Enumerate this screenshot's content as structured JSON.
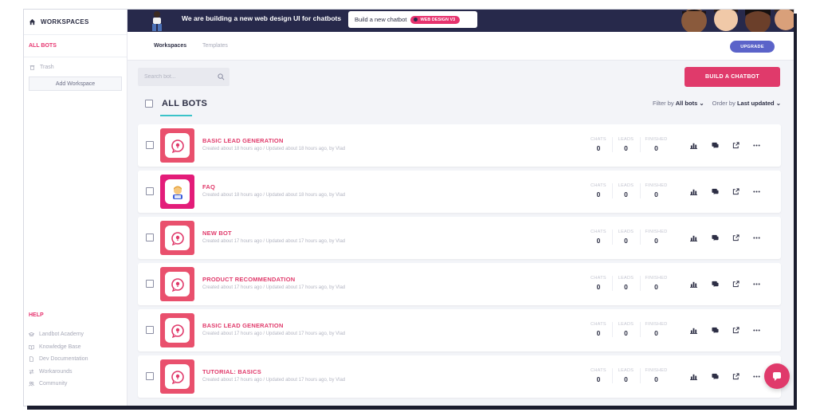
{
  "sidebar": {
    "workspaces_label": "WORKSPACES",
    "all_bots_label": "ALL BOTS",
    "trash_label": "Trash",
    "add_workspace_label": "Add Workspace",
    "help_title": "HELP",
    "help_items": [
      {
        "label": "Landbot Academy",
        "icon": "graduation-icon"
      },
      {
        "label": "Knowledge Base",
        "icon": "book-icon"
      },
      {
        "label": "Dev Documentation",
        "icon": "document-icon"
      },
      {
        "label": "Workarounds",
        "icon": "swap-icon"
      },
      {
        "label": "Community",
        "icon": "people-icon"
      }
    ]
  },
  "banner": {
    "text": "We are building a new web design UI for chatbots",
    "pill_text": "Build a new chatbot",
    "badge_text": "WEB DESIGN V3"
  },
  "topnav": {
    "tabs": [
      "Workspaces",
      "Templates"
    ],
    "upgrade_label": "UPGRADE"
  },
  "search": {
    "placeholder": "Search bot..."
  },
  "build_button_label": "BUILD A CHATBOT",
  "list": {
    "title": "ALL BOTS",
    "filter_label": "Filter by",
    "filter_value": "All bots",
    "order_label": "Order by",
    "order_value": "Last updated"
  },
  "stat_labels": {
    "chats": "CHATS",
    "leads": "LEADS",
    "finished": "FINISHED"
  },
  "bots": [
    {
      "name": "BASIC LEAD GENERATION",
      "meta": "Created about 18 hours ago / Updated about 18 hours ago, by Vlad",
      "chats": "0",
      "leads": "0",
      "finished": "0",
      "icon": "chat-bubble-icon"
    },
    {
      "name": "FAQ",
      "meta": "Created about 18 hours ago / Updated about 18 hours ago, by Vlad",
      "chats": "0",
      "leads": "0",
      "finished": "0",
      "icon": "person-emoji-icon"
    },
    {
      "name": "NEW BOT",
      "meta": "Created about 17 hours ago / Updated about 17 hours ago, by Vlad",
      "chats": "0",
      "leads": "0",
      "finished": "0",
      "icon": "chat-bubble-icon"
    },
    {
      "name": "PRODUCT RECOMMENDATION",
      "meta": "Created about 17 hours ago / Updated about 17 hours ago, by Vlad",
      "chats": "0",
      "leads": "0",
      "finished": "0",
      "icon": "chat-bubble-icon"
    },
    {
      "name": "BASIC LEAD GENERATION",
      "meta": "Created about 17 hours ago / Updated about 17 hours ago, by Vlad",
      "chats": "0",
      "leads": "0",
      "finished": "0",
      "icon": "chat-bubble-icon"
    },
    {
      "name": "TUTORIAL: BASICS",
      "meta": "Created about 17 hours ago / Updated about 17 hours ago, by Vlad",
      "chats": "0",
      "leads": "0",
      "finished": "0",
      "icon": "chat-bubble-icon"
    }
  ],
  "colors": {
    "accent": "#e03a6b",
    "banner": "#27294b",
    "upgrade": "#5b63c9",
    "tab_underline": "#3bc3c9"
  }
}
